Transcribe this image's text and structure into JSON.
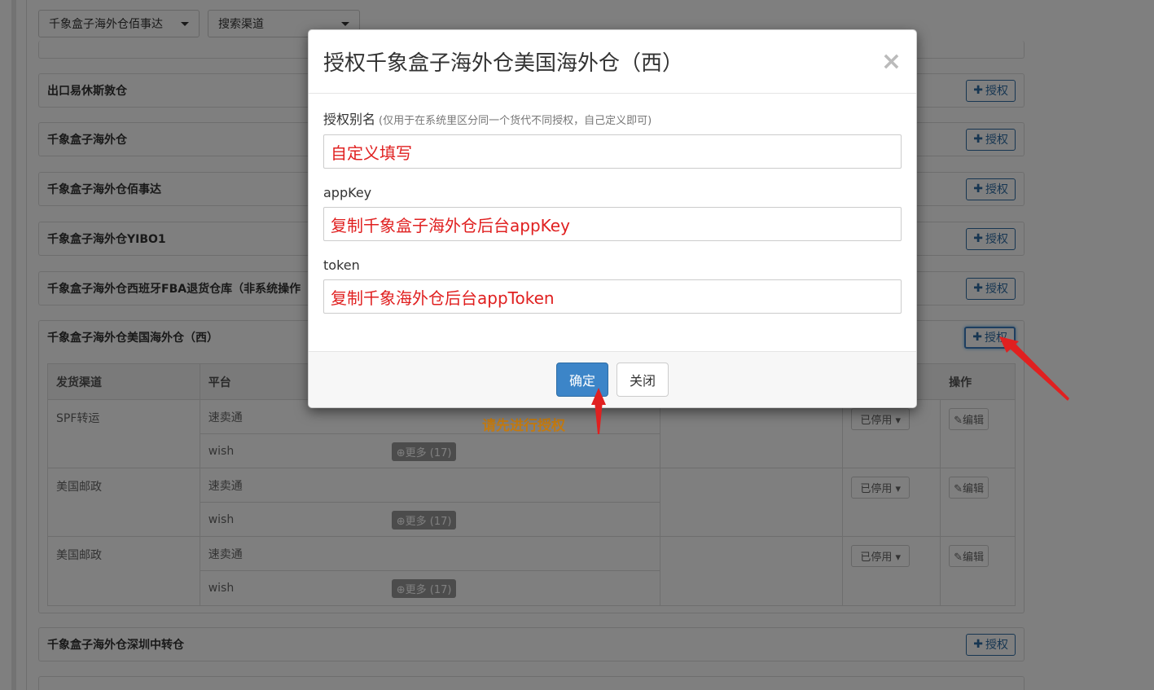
{
  "filters": {
    "select1": "千象盒子海外仓佰事达",
    "select2": "搜索渠道"
  },
  "panels": [
    {
      "title": "出口易休斯敦仓",
      "button": "授权"
    },
    {
      "title": "千象盒子海外仓",
      "button": "授权"
    },
    {
      "title": "千象盒子海外仓佰事达",
      "button": "授权"
    },
    {
      "title": "千象盒子海外仓YIBO1",
      "button": "授权"
    },
    {
      "title": "千象盒子海外仓西班牙FBA退货仓库（非系统操作",
      "button": "授权"
    },
    {
      "title": "千象盒子海外仓美国海外仓（西）",
      "button": "授权"
    },
    {
      "title": "千象盒子海外仓深圳中转仓",
      "button": "授权"
    },
    {
      "title": "",
      "button": ""
    }
  ],
  "table": {
    "headers": [
      "发货渠道",
      "平台",
      "操作"
    ],
    "groups": [
      {
        "channel": "SPF转运",
        "rows": [
          {
            "platform": "速卖通",
            "more": ""
          },
          {
            "platform": "wish",
            "more": "更多 (17)"
          }
        ],
        "status": "已停用",
        "edit": "编辑"
      },
      {
        "channel": "美国邮政",
        "rows": [
          {
            "platform": "速卖通",
            "more": ""
          },
          {
            "platform": "wish",
            "more": "更多 (17)"
          }
        ],
        "status": "已停用",
        "edit": "编辑"
      },
      {
        "channel": "美国邮政",
        "rows": [
          {
            "platform": "速卖通",
            "more": ""
          },
          {
            "platform": "wish",
            "more": "更多 (17)"
          }
        ],
        "status": "已停用",
        "edit": "编辑"
      }
    ]
  },
  "hint": "请先进行授权",
  "modal": {
    "title": "授权千象盒子海外仓美国海外仓（西）",
    "close": "×",
    "fields": {
      "alias_label": "授权别名",
      "alias_hint": "(仅用于在系统里区分同一个货代不同授权，自己定义即可)",
      "alias_value": "自定义填写",
      "appkey_label": "appKey",
      "appkey_value": "复制千象盒子海外仓后台appKey",
      "token_label": "token",
      "token_value": "复制千象海外仓后台appToken"
    },
    "confirm": "确定",
    "cancel": "关闭"
  },
  "colors": {
    "accent": "#3c85c8",
    "annotation": "#e02020",
    "hint": "#c37a10"
  }
}
